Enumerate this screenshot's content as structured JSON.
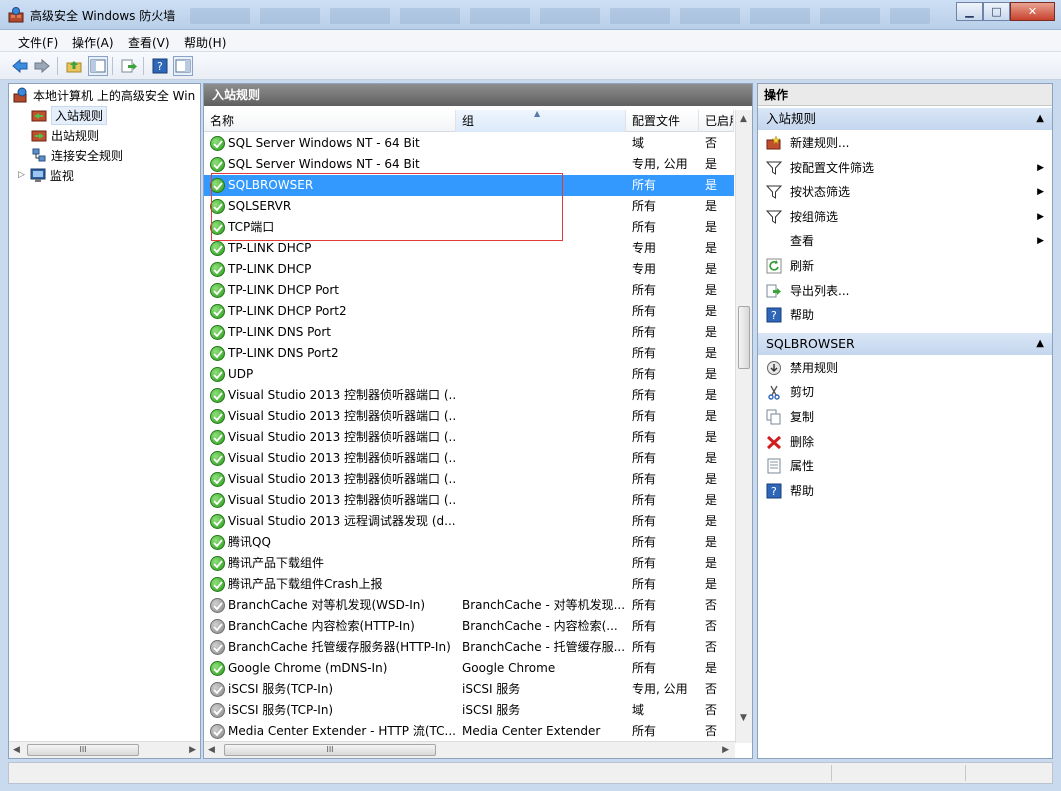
{
  "window": {
    "title": "高级安全 Windows 防火墙",
    "controls": [
      "minimize",
      "maximize",
      "close"
    ]
  },
  "menu": [
    "文件(F)",
    "操作(A)",
    "查看(V)",
    "帮助(H)"
  ],
  "toolbar": [
    "back-icon",
    "forward-icon",
    "up-folder-icon",
    "show-hide-tree-icon",
    "export-icon",
    "help-icon",
    "show-hide-action-pane-icon"
  ],
  "tree": {
    "root": "本地计算机 上的高级安全 Win",
    "items": [
      {
        "label": "入站规则",
        "selected": true
      },
      {
        "label": "出站规则"
      },
      {
        "label": "连接安全规则"
      },
      {
        "label": "监视",
        "expandable": true
      }
    ]
  },
  "main": {
    "section_title": "入站规则",
    "columns": [
      "名称",
      "组",
      "配置文件",
      "已启用"
    ],
    "rows": [
      {
        "name": "SQL Server Windows NT - 64 Bit",
        "group": "",
        "profile": "域",
        "enabled": "否",
        "on": true
      },
      {
        "name": "SQL Server Windows NT - 64 Bit",
        "group": "",
        "profile": "专用, 公用",
        "enabled": "是",
        "on": true
      },
      {
        "name": "SQLBROWSER",
        "group": "",
        "profile": "所有",
        "enabled": "是",
        "on": true,
        "selected": true
      },
      {
        "name": "SQLSERVR",
        "group": "",
        "profile": "所有",
        "enabled": "是",
        "on": true
      },
      {
        "name": "TCP端口",
        "group": "",
        "profile": "所有",
        "enabled": "是",
        "on": true
      },
      {
        "name": "TP-LINK DHCP",
        "group": "",
        "profile": "专用",
        "enabled": "是",
        "on": true
      },
      {
        "name": "TP-LINK DHCP",
        "group": "",
        "profile": "专用",
        "enabled": "是",
        "on": true
      },
      {
        "name": "TP-LINK DHCP Port",
        "group": "",
        "profile": "所有",
        "enabled": "是",
        "on": true
      },
      {
        "name": "TP-LINK DHCP Port2",
        "group": "",
        "profile": "所有",
        "enabled": "是",
        "on": true
      },
      {
        "name": "TP-LINK DNS Port",
        "group": "",
        "profile": "所有",
        "enabled": "是",
        "on": true
      },
      {
        "name": "TP-LINK DNS Port2",
        "group": "",
        "profile": "所有",
        "enabled": "是",
        "on": true
      },
      {
        "name": "UDP",
        "group": "",
        "profile": "所有",
        "enabled": "是",
        "on": true
      },
      {
        "name": "Visual Studio 2013 控制器侦听器端口 (...",
        "group": "",
        "profile": "所有",
        "enabled": "是",
        "on": true
      },
      {
        "name": "Visual Studio 2013 控制器侦听器端口 (...",
        "group": "",
        "profile": "所有",
        "enabled": "是",
        "on": true
      },
      {
        "name": "Visual Studio 2013 控制器侦听器端口 (...",
        "group": "",
        "profile": "所有",
        "enabled": "是",
        "on": true
      },
      {
        "name": "Visual Studio 2013 控制器侦听器端口 (...",
        "group": "",
        "profile": "所有",
        "enabled": "是",
        "on": true
      },
      {
        "name": "Visual Studio 2013 控制器侦听器端口 (...",
        "group": "",
        "profile": "所有",
        "enabled": "是",
        "on": true
      },
      {
        "name": "Visual Studio 2013 控制器侦听器端口 (...",
        "group": "",
        "profile": "所有",
        "enabled": "是",
        "on": true
      },
      {
        "name": "Visual Studio 2013 远程调试器发现 (d...",
        "group": "",
        "profile": "所有",
        "enabled": "是",
        "on": true
      },
      {
        "name": "腾讯QQ",
        "group": "",
        "profile": "所有",
        "enabled": "是",
        "on": true
      },
      {
        "name": "腾讯产品下载组件",
        "group": "",
        "profile": "所有",
        "enabled": "是",
        "on": true
      },
      {
        "name": "腾讯产品下载组件Crash上报",
        "group": "",
        "profile": "所有",
        "enabled": "是",
        "on": true
      },
      {
        "name": "BranchCache 对等机发现(WSD-In)",
        "group": "BranchCache - 对等机发现...",
        "profile": "所有",
        "enabled": "否",
        "on": false
      },
      {
        "name": "BranchCache 内容检索(HTTP-In)",
        "group": "BranchCache - 内容检索(...",
        "profile": "所有",
        "enabled": "否",
        "on": false
      },
      {
        "name": "BranchCache 托管缓存服务器(HTTP-In)",
        "group": "BranchCache - 托管缓存服...",
        "profile": "所有",
        "enabled": "否",
        "on": false
      },
      {
        "name": "Google Chrome (mDNS-In)",
        "group": "Google Chrome",
        "profile": "所有",
        "enabled": "是",
        "on": true
      },
      {
        "name": "iSCSI 服务(TCP-In)",
        "group": "iSCSI 服务",
        "profile": "专用, 公用",
        "enabled": "否",
        "on": false
      },
      {
        "name": "iSCSI 服务(TCP-In)",
        "group": "iSCSI 服务",
        "profile": "域",
        "enabled": "否",
        "on": false
      },
      {
        "name": "Media Center Extender - HTTP 流(TC...",
        "group": "Media Center Extender",
        "profile": "所有",
        "enabled": "否",
        "on": false
      }
    ]
  },
  "actions": {
    "title": "操作",
    "groups": [
      {
        "title": "入站规则",
        "items": [
          {
            "label": "新建规则...",
            "icon": "new-rule-icon"
          },
          {
            "label": "按配置文件筛选",
            "icon": "filter-icon",
            "submenu": true
          },
          {
            "label": "按状态筛选",
            "icon": "filter-icon",
            "submenu": true
          },
          {
            "label": "按组筛选",
            "icon": "filter-icon",
            "submenu": true
          },
          {
            "label": "查看",
            "icon": "",
            "submenu": true
          },
          {
            "label": "刷新",
            "icon": "refresh-icon"
          },
          {
            "label": "导出列表...",
            "icon": "export-icon"
          },
          {
            "label": "帮助",
            "icon": "help-icon"
          }
        ]
      },
      {
        "title": "SQLBROWSER",
        "items": [
          {
            "label": "禁用规则",
            "icon": "disable-icon"
          },
          {
            "label": "剪切",
            "icon": "cut-icon"
          },
          {
            "label": "复制",
            "icon": "copy-icon"
          },
          {
            "label": "删除",
            "icon": "delete-icon"
          },
          {
            "label": "属性",
            "icon": "properties-icon"
          },
          {
            "label": "帮助",
            "icon": "help-icon"
          }
        ]
      }
    ]
  }
}
